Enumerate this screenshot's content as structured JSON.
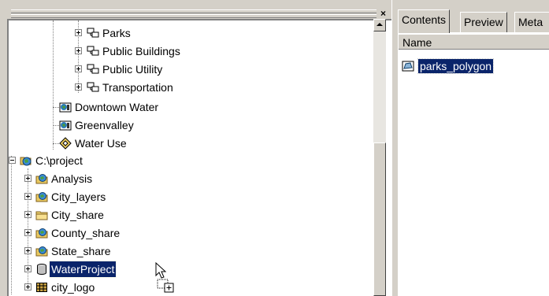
{
  "tree": {
    "close_glyph": "×",
    "nodes": [
      {
        "label": "Parks",
        "icon": "layer-group-icon",
        "expander": "plus"
      },
      {
        "label": "Public Buildings",
        "icon": "layer-group-icon",
        "expander": "plus"
      },
      {
        "label": "Public Utility",
        "icon": "layer-group-icon",
        "expander": "plus"
      },
      {
        "label": "Transportation",
        "icon": "layer-group-icon",
        "expander": "plus"
      },
      {
        "label": "Downtown Water",
        "icon": "map-document-icon"
      },
      {
        "label": "Greenvalley",
        "icon": "map-document-icon"
      },
      {
        "label": "Water Use",
        "icon": "diamond-layer-icon"
      },
      {
        "label": "C:\\project",
        "icon": "folder-connection-icon",
        "expander": "minus"
      },
      {
        "label": "Analysis",
        "icon": "geodatabase-folder-icon",
        "expander": "plus"
      },
      {
        "label": "City_layers",
        "icon": "geodatabase-folder-icon",
        "expander": "plus"
      },
      {
        "label": "City_share",
        "icon": "folder-icon",
        "expander": "plus"
      },
      {
        "label": "County_share",
        "icon": "geodatabase-folder-icon",
        "expander": "plus"
      },
      {
        "label": "State_share",
        "icon": "geodatabase-folder-icon",
        "expander": "plus"
      },
      {
        "label": "WaterProject",
        "icon": "database-icon",
        "expander": "plus",
        "selected": true
      },
      {
        "label": "city_logo",
        "icon": "raster-grid-icon",
        "expander": "plus"
      }
    ]
  },
  "tabs": [
    {
      "label": "Contents",
      "active": true
    },
    {
      "label": "Preview",
      "active": false
    },
    {
      "label": "Meta",
      "active": false
    }
  ],
  "contents": {
    "column_header": "Name",
    "items": [
      {
        "label": "parks_polygon",
        "icon": "polygon-feature-class-icon",
        "selected": true
      }
    ]
  },
  "colors": {
    "selection": "#0a246a",
    "chrome": "#d4d0c8"
  }
}
